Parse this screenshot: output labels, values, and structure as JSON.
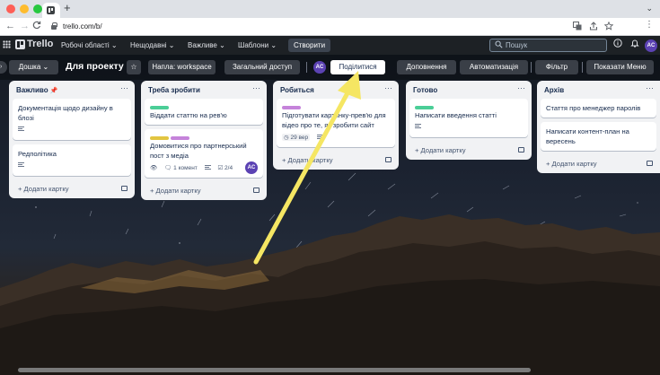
{
  "browser": {
    "url": "trello.com/b/",
    "new_tab_glyph": "+",
    "tab_menu_glyph": "⌄",
    "nav_back": "←",
    "nav_forward": "→",
    "nav_reload": "C",
    "more_glyph": "⋮"
  },
  "header": {
    "logo_text": "Trello",
    "menus": [
      "Робочі області ⌄",
      "Нещодавні ⌄",
      "Важливе ⌄",
      "Шаблони ⌄"
    ],
    "create_label": "Створити",
    "search_placeholder": "Пошук",
    "user_initials": "AC"
  },
  "board_bar": {
    "view_label": "Дошка ⌄",
    "board_title": "Для проекту",
    "workspace_label": "Напла: workspace",
    "visibility_label": "Загальний доступ",
    "member_initials": "AC",
    "share_label": "Поділитися",
    "powerups_label": "Доповнення",
    "automation_label": "Автоматизація",
    "filter_label": "Фільтр",
    "menu_label": "Показати Меню"
  },
  "lists": [
    {
      "title": "Важливо",
      "pinned": true,
      "cards": [
        {
          "text": "Документація щодо дизайну в блозі",
          "has_description": true
        },
        {
          "text": "Редполітика",
          "has_description": true
        }
      ],
      "add_label": "+ Додати картку"
    },
    {
      "title": "Треба зробити",
      "cards": [
        {
          "text": "Віддати статтю на рев'ю",
          "labels": [
            "green"
          ]
        },
        {
          "text": "Домовитися про партнерський пост з медіа",
          "labels": [
            "yellow",
            "purple"
          ],
          "watch": true,
          "comments": "1 комент",
          "has_description": true,
          "checklist": "2/4",
          "member": "AC"
        }
      ],
      "add_label": "+ Додати картку"
    },
    {
      "title": "Робиться",
      "cards": [
        {
          "text": "Підготувати картинку-прев'ю для відео про те, як зробити сайт",
          "labels": [
            "purple"
          ],
          "date": "29 вер",
          "has_description": true
        }
      ],
      "add_label": "+ Додати картку"
    },
    {
      "title": "Готово",
      "cards": [
        {
          "text": "Написати введення статті",
          "labels": [
            "green"
          ],
          "has_description": true
        }
      ],
      "add_label": "+ Додати картку"
    },
    {
      "title": "Архів",
      "cards": [
        {
          "text": "Стаття про менеджер паролів"
        },
        {
          "text": "Написати контент-план на вересень"
        }
      ],
      "add_label": "+ Додати картку"
    }
  ],
  "colors": {
    "label_green": "#4bce97",
    "label_yellow": "#e2c541",
    "label_purple": "#c583da",
    "avatar": "#5b42b3",
    "annotation_arrow": "#f5e663"
  },
  "icons": {
    "nav_arrow": "yellow annotation arrow pointing to share button"
  }
}
